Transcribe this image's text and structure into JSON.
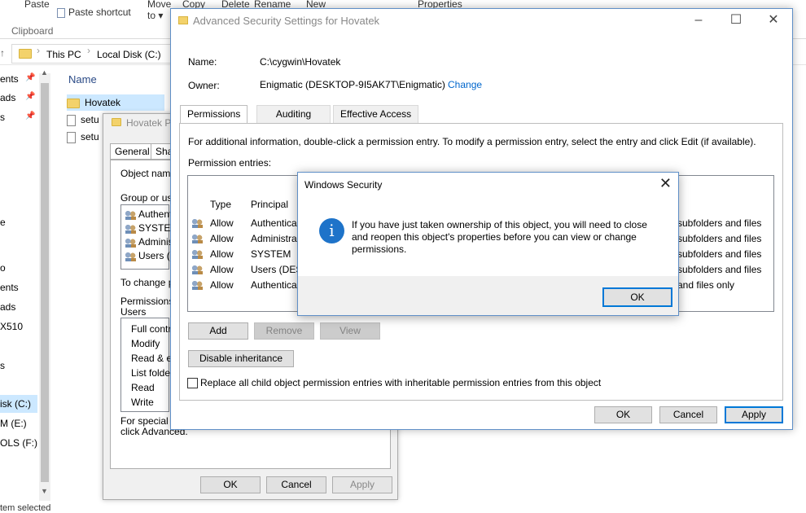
{
  "explorer": {
    "ribbon": {
      "paste": "Paste",
      "paste_shortcut": "Paste shortcut",
      "move_to_1": "Move",
      "move_to_2": "to ▾",
      "copy": "Copy",
      "delete": "Delete",
      "rename": "Rename",
      "new": "New",
      "properties": "Properties",
      "clipboard": "Clipboard"
    },
    "breadcrumb": [
      "This PC",
      "Local Disk (C:)"
    ],
    "nav_items": [
      "ents",
      "ads",
      "s",
      "e",
      "o",
      "ents",
      "ads",
      "X510",
      "s",
      "isk (C:)",
      "M (E:)",
      "OLS (F:)"
    ],
    "column_name": "Name",
    "files": [
      "Hovatek",
      "setu",
      "setu"
    ],
    "status": "tem selected"
  },
  "properties": {
    "title": "Hovatek P",
    "tabs": [
      "General",
      "Sha"
    ],
    "object_name_label": "Object name",
    "group_label": "Group or use",
    "groups": [
      "Authent",
      "SYSTEM",
      "Adminis",
      "Users (D"
    ],
    "change_label": "To change p",
    "permissions_label_1": "Permissions f",
    "permissions_label_2": "Users",
    "permissions": [
      "Full contro",
      "Modify",
      "Read & ex",
      "List folder",
      "Read",
      "Write"
    ],
    "special_1": "For special p",
    "special_2": "click Advanced.",
    "ok": "OK",
    "cancel": "Cancel",
    "apply": "Apply"
  },
  "advanced": {
    "title": "Advanced Security Settings for Hovatek",
    "name_label": "Name:",
    "name_value": "C:\\cygwin\\Hovatek",
    "owner_label": "Owner:",
    "owner_value": "Enigmatic (DESKTOP-9I5AK7T\\Enigmatic)",
    "change_link": "Change",
    "tabs": [
      "Permissions",
      "Auditing",
      "Effective Access"
    ],
    "info_text": "For additional information, double-click a permission entry. To modify a permission entry, select the entry and click Edit (if available).",
    "entries_label": "Permission entries:",
    "col_type": "Type",
    "col_principal": "Principal",
    "entries": [
      {
        "type": "Allow",
        "principal": "Authentica",
        "applies": "subfolders and files"
      },
      {
        "type": "Allow",
        "principal": "Administra",
        "applies": "subfolders and files"
      },
      {
        "type": "Allow",
        "principal": "SYSTEM",
        "applies": "subfolders and files"
      },
      {
        "type": "Allow",
        "principal": "Users (DESK",
        "applies": "subfolders and files"
      },
      {
        "type": "Allow",
        "principal": "Authentica",
        "applies": "and files only"
      }
    ],
    "add": "Add",
    "remove": "Remove",
    "view": "View",
    "disable_inheritance": "Disable inheritance",
    "replace_label": "Replace all child object permission entries with inheritable permission entries from this object",
    "ok": "OK",
    "cancel": "Cancel",
    "apply": "Apply"
  },
  "dialog": {
    "title": "Windows Security",
    "message": "If you have just taken ownership of this object, you will need to close and reopen this object's properties before you can view or change permissions.",
    "ok": "OK"
  }
}
